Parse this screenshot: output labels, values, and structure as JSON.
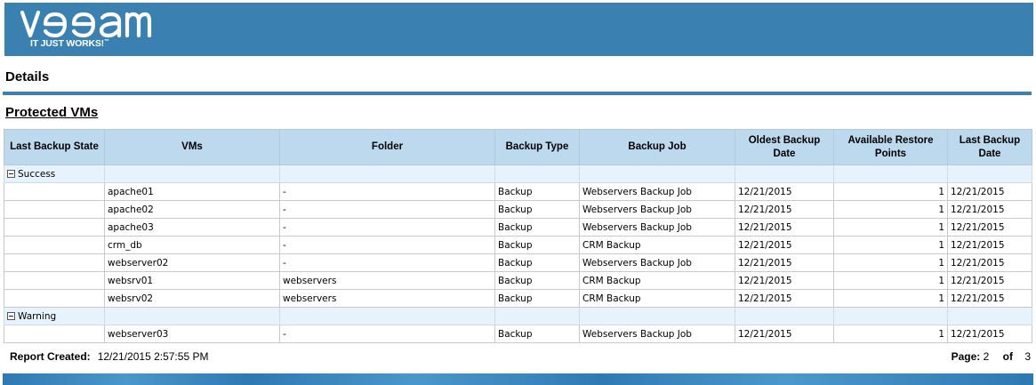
{
  "brand": {
    "logo_word": "veeam",
    "tagline": "IT JUST WORKS!",
    "tagline_mark": "™",
    "banner_color": "#3a80b0"
  },
  "report": {
    "section_title": "Details",
    "subsection_title": "Protected VMs"
  },
  "table": {
    "columns": [
      "Last Backup State",
      "VMs",
      "Folder",
      "Backup Type",
      "Backup Job",
      "Oldest Backup Date",
      "Available Restore Points",
      "Last Backup Date"
    ],
    "groups": [
      {
        "state": "Success",
        "toggle_icon": "collapse-minus-icon",
        "rows": [
          {
            "vm": "apache01",
            "folder": "-",
            "backup_type": "Backup",
            "backup_job": "Webservers Backup Job",
            "oldest_backup": "12/21/2015",
            "restore_points": "1",
            "last_backup": "12/21/2015"
          },
          {
            "vm": "apache02",
            "folder": "-",
            "backup_type": "Backup",
            "backup_job": "Webservers Backup Job",
            "oldest_backup": "12/21/2015",
            "restore_points": "1",
            "last_backup": "12/21/2015"
          },
          {
            "vm": "apache03",
            "folder": "-",
            "backup_type": "Backup",
            "backup_job": "Webservers Backup Job",
            "oldest_backup": "12/21/2015",
            "restore_points": "1",
            "last_backup": "12/21/2015"
          },
          {
            "vm": "crm_db",
            "folder": "-",
            "backup_type": "Backup",
            "backup_job": "CRM Backup",
            "oldest_backup": "12/21/2015",
            "restore_points": "1",
            "last_backup": "12/21/2015"
          },
          {
            "vm": "webserver02",
            "folder": "-",
            "backup_type": "Backup",
            "backup_job": "Webservers Backup Job",
            "oldest_backup": "12/21/2015",
            "restore_points": "1",
            "last_backup": "12/21/2015"
          },
          {
            "vm": "websrv01",
            "folder": "webservers",
            "backup_type": "Backup",
            "backup_job": "CRM Backup",
            "oldest_backup": "12/21/2015",
            "restore_points": "1",
            "last_backup": "12/21/2015"
          },
          {
            "vm": "websrv02",
            "folder": "webservers",
            "backup_type": "Backup",
            "backup_job": "CRM Backup",
            "oldest_backup": "12/21/2015",
            "restore_points": "1",
            "last_backup": "12/21/2015"
          }
        ]
      },
      {
        "state": "Warning",
        "toggle_icon": "collapse-minus-icon",
        "rows": [
          {
            "vm": "webserver03",
            "folder": "-",
            "backup_type": "Backup",
            "backup_job": "Webservers Backup Job",
            "oldest_backup": "12/21/2015",
            "restore_points": "1",
            "last_backup": "12/21/2015"
          }
        ]
      }
    ]
  },
  "footer": {
    "created_label": "Report Created:",
    "created_value": "12/21/2015 2:57:55 PM",
    "page_label": "Page:",
    "page_current": "2",
    "page_of": "of",
    "page_total": "3"
  }
}
